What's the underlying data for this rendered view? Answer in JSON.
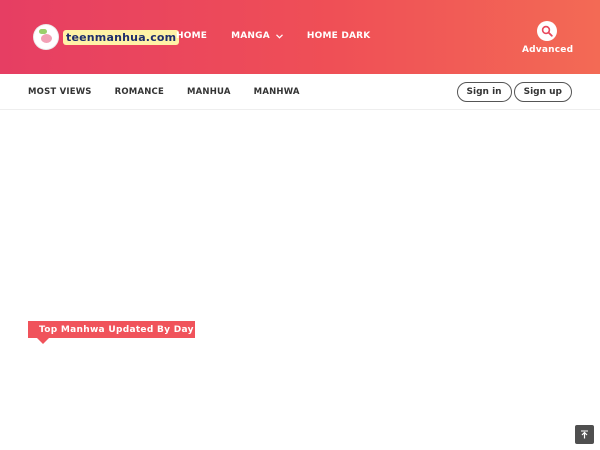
{
  "header": {
    "logo_text": "teenmanhua.com",
    "nav": [
      {
        "label": "HOME"
      },
      {
        "label": "MANGA"
      },
      {
        "label": "HOME DARK"
      }
    ],
    "advanced_label": "Advanced"
  },
  "subnav": {
    "links": [
      {
        "label": "MOST VIEWS"
      },
      {
        "label": "ROMANCE"
      },
      {
        "label": "MANHUA"
      },
      {
        "label": "MANHWA"
      }
    ],
    "sign_in": "Sign in",
    "sign_up": "Sign up"
  },
  "section": {
    "title": "Top Manhwa Updated By Day"
  },
  "colors": {
    "header_start": "#e63e63",
    "header_end": "#f36a55",
    "accent": "#f0535b"
  }
}
